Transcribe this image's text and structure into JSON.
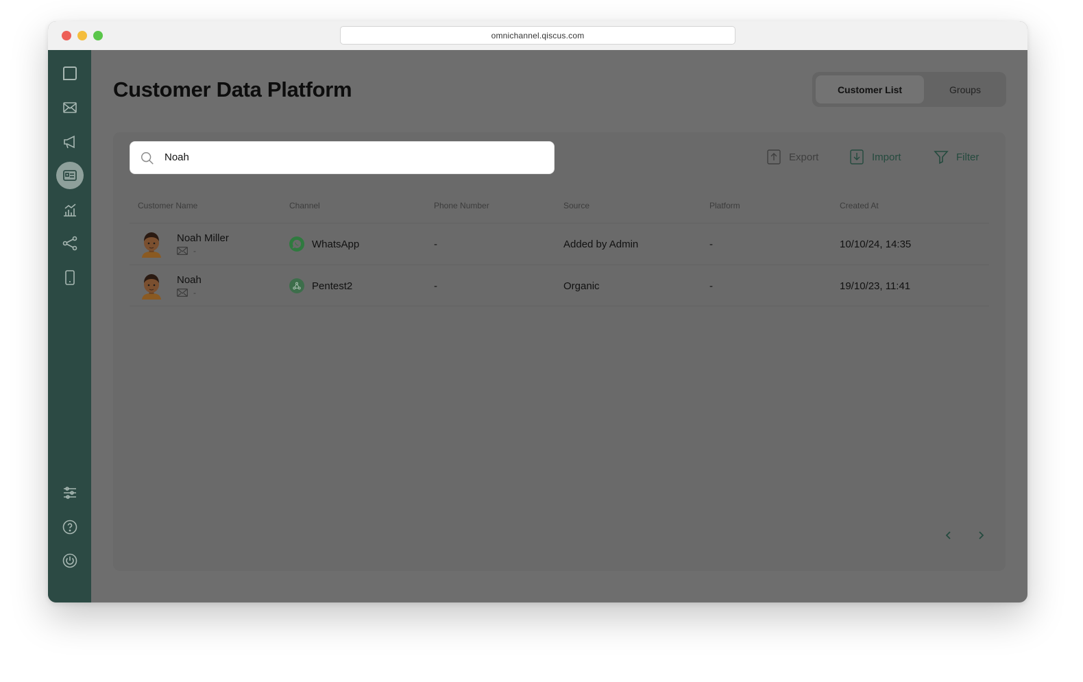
{
  "browser": {
    "url": "omnichannel.qiscus.com"
  },
  "sidebar": {
    "items": [
      {
        "icon": "chat-bubble-icon"
      },
      {
        "icon": "envelope-icon"
      },
      {
        "icon": "megaphone-icon"
      },
      {
        "icon": "contact-card-icon",
        "active": true
      },
      {
        "icon": "analytics-chart-icon"
      },
      {
        "icon": "integration-share-icon"
      },
      {
        "icon": "mobile-device-icon"
      },
      {
        "icon": "settings-sliders-icon"
      },
      {
        "icon": "help-circle-icon"
      },
      {
        "icon": "power-icon"
      }
    ]
  },
  "header": {
    "title": "Customer Data Platform",
    "tabs": [
      {
        "label": "Customer List",
        "active": true
      },
      {
        "label": "Groups",
        "active": false
      }
    ]
  },
  "toolbar": {
    "search_value": "Noah",
    "export_label": "Export",
    "import_label": "Import",
    "filter_label": "Filter"
  },
  "table": {
    "columns": [
      "Customer Name",
      "Channel",
      "Phone Number",
      "Source",
      "Platform",
      "Created At"
    ],
    "rows": [
      {
        "name": "Noah Miller",
        "email": "-",
        "channel": "WhatsApp",
        "channel_icon": "whatsapp-icon",
        "phone": "-",
        "source": "Added by Admin",
        "platform": "-",
        "created_at": "10/10/24, 14:35"
      },
      {
        "name": "Noah",
        "email": "-",
        "channel": "Pentest2",
        "channel_icon": "qiscus-widget-icon",
        "phone": "-",
        "source": "Organic",
        "platform": "-",
        "created_at": "19/10/23, 11:41"
      }
    ]
  },
  "colors": {
    "sidebar": "#2c4a44",
    "overlay": "#6e6e6e",
    "accent": "#244a3e",
    "whatsapp": "#2f7a3f"
  }
}
